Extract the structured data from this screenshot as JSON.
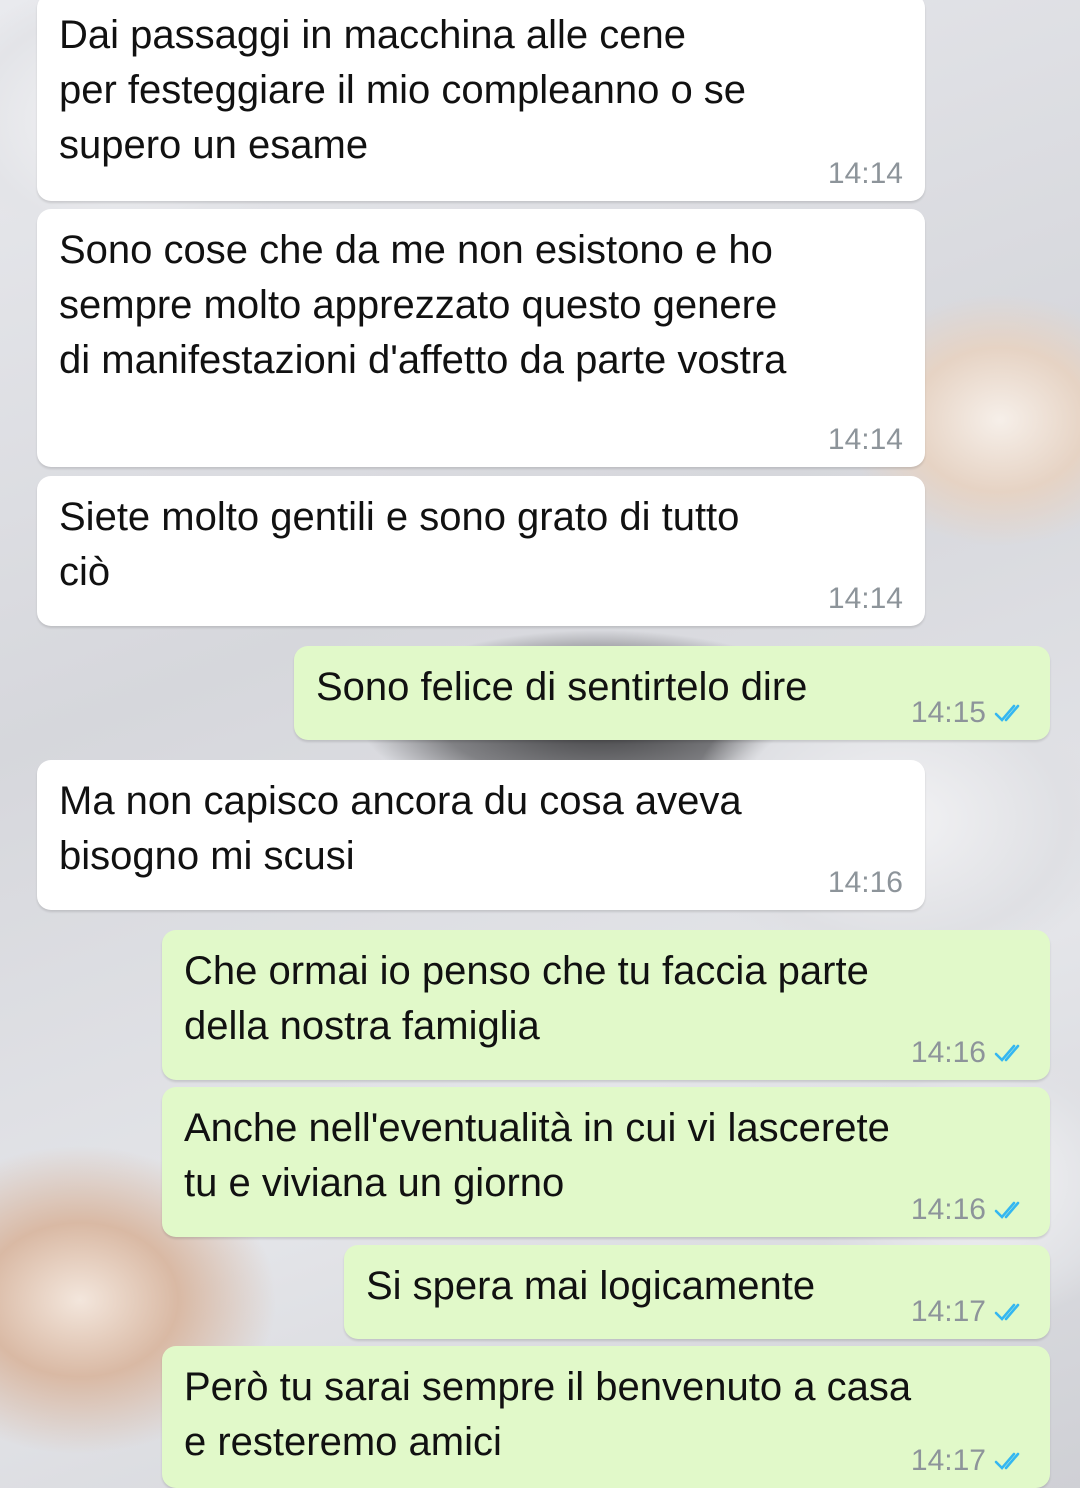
{
  "messages": [
    {
      "direction": "in",
      "text": "Dai passaggi in macchina alle cene\nper festeggiare il mio compleanno o se\nsupero un esame",
      "time": "14:14"
    },
    {
      "direction": "in",
      "text": "Sono cose che da me non esistono e ho\nsempre molto apprezzato questo genere\ndi manifestazioni d'affetto da parte vostra",
      "time": "14:14"
    },
    {
      "direction": "in",
      "text": "Siete molto gentili e sono grato di tutto\nciò",
      "time": "14:14"
    },
    {
      "direction": "out",
      "text": "Sono felice di sentirtelo dire",
      "time": "14:15",
      "status": "read-double-check-icon"
    },
    {
      "direction": "in",
      "text": "Ma non capisco ancora du cosa aveva\nbisogno mi scusi",
      "time": "14:16"
    },
    {
      "direction": "out",
      "text": "Che ormai io penso che tu faccia parte\ndella nostra famiglia",
      "time": "14:16",
      "status": "read-double-check-icon"
    },
    {
      "direction": "out",
      "text": "Anche nell'eventualità in cui vi lascerete\ntu e viviana un giorno",
      "time": "14:16",
      "status": "read-double-check-icon"
    },
    {
      "direction": "out",
      "text": "Si spera mai logicamente",
      "time": "14:17",
      "status": "read-double-check-icon"
    },
    {
      "direction": "out",
      "text": "Però tu sarai sempre il benvenuto a casa\ne resteremo amici",
      "time": "14:17",
      "status": "read-double-check-icon"
    }
  ],
  "colors": {
    "incoming_bubble": "#ffffff",
    "outgoing_bubble": "#e1f9c9",
    "timestamp": "#8d949a",
    "read_ticks": "#34b7f1"
  }
}
